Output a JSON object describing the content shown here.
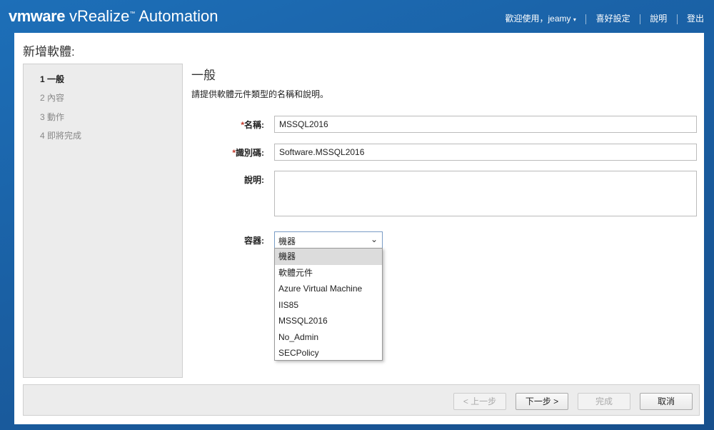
{
  "header": {
    "brand": "vmware",
    "product": "vRealize",
    "product_suffix": "Automation",
    "tm": "™",
    "welcome": "歡迎使用，jeamy",
    "preferences": "喜好設定",
    "help": "說明",
    "logout": "登出"
  },
  "page": {
    "title": "新增軟體:"
  },
  "steps": [
    {
      "label": "1 一般",
      "active": true
    },
    {
      "label": "2 內容",
      "active": false
    },
    {
      "label": "3 動作",
      "active": false
    },
    {
      "label": "4 即將完成",
      "active": false
    }
  ],
  "section": {
    "title": "一般",
    "description": "請提供軟體元件類型的名稱和說明。"
  },
  "form": {
    "name_label": "名稱:",
    "name_value": "MSSQL2016",
    "id_label": "識別碼:",
    "id_value": "Software.MSSQL2016",
    "desc_label": "說明:",
    "desc_value": "",
    "container_label": "容器:",
    "container_value": "機器",
    "required_mark": "*"
  },
  "container_options": [
    "機器",
    "軟體元件",
    "Azure Virtual Machine",
    "IIS85",
    "MSSQL2016",
    "No_Admin",
    "SECPolicy"
  ],
  "buttons": {
    "prev": "< 上一步",
    "next": "下一步 >",
    "finish": "完成",
    "cancel": "取消"
  }
}
